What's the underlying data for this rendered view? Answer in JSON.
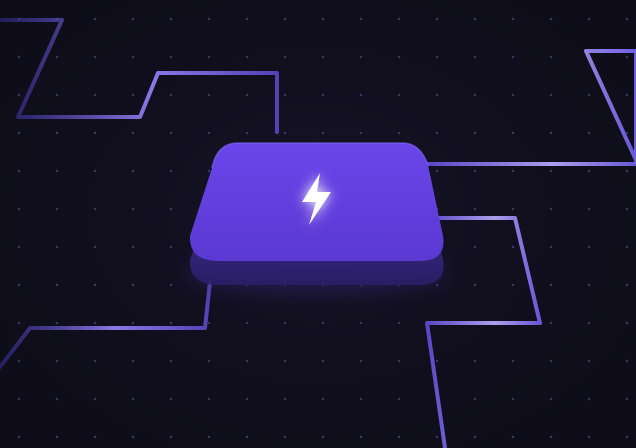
{
  "scene": {
    "icon": "lightning-bolt-icon",
    "colors": {
      "background": "#0f0e1b",
      "grid_dot": "#3a4a7a",
      "trace_dark": "#3b2f9a",
      "trace_light": "#a99cf2",
      "chip_top": "#6440e6",
      "chip_bottom": "#5a39cf",
      "chip_side": "#3a2a8a",
      "bolt": "#ffffff"
    }
  }
}
